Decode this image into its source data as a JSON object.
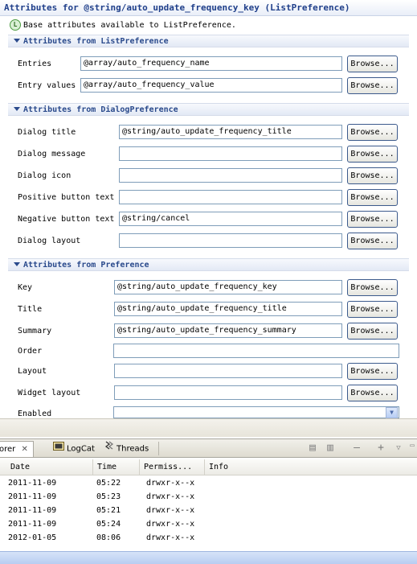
{
  "header": {
    "title": "Attributes for @string/auto_update_frequency_key (ListPreference)"
  },
  "base": {
    "badge": "L",
    "text": "Base attributes available to ListPreference."
  },
  "browse_label": "Browse...",
  "sections": {
    "list": {
      "title": "Attributes from ListPreference",
      "rows": [
        {
          "label": "Entries",
          "value": "@array/auto_frequency_name"
        },
        {
          "label": "Entry values",
          "value": "@array/auto_frequency_value"
        }
      ]
    },
    "dialog": {
      "title": "Attributes from DialogPreference",
      "rows": [
        {
          "label": "Dialog title",
          "value": "@string/auto_update_frequency_title"
        },
        {
          "label": "Dialog message",
          "value": ""
        },
        {
          "label": "Dialog icon",
          "value": ""
        },
        {
          "label": "Positive button text",
          "value": ""
        },
        {
          "label": "Negative button text",
          "value": "@string/cancel"
        },
        {
          "label": "Dialog layout",
          "value": ""
        }
      ]
    },
    "pref": {
      "title": "Attributes from Preference",
      "rows": [
        {
          "label": "Key",
          "value": "@string/auto_update_frequency_key"
        },
        {
          "label": "Title",
          "value": "@string/auto_update_frequency_title"
        },
        {
          "label": "Summary",
          "value": "@string/auto_update_frequency_summary"
        },
        {
          "label": "Order",
          "value": ""
        },
        {
          "label": "Layout",
          "value": ""
        },
        {
          "label": "Widget layout",
          "value": ""
        },
        {
          "label": "Enabled",
          "value": ""
        }
      ]
    }
  },
  "views": {
    "tabs": [
      {
        "label": "orer"
      },
      {
        "label": "LogCat"
      },
      {
        "label": "Threads"
      }
    ]
  },
  "table": {
    "columns": [
      "Date",
      "Time",
      "Permiss...",
      "Info"
    ],
    "rows": [
      [
        "2011-11-09",
        "05:22",
        "drwxr-x--x",
        ""
      ],
      [
        "2011-11-09",
        "05:23",
        "drwxr-x--x",
        ""
      ],
      [
        "2011-11-09",
        "05:21",
        "drwxr-x--x",
        ""
      ],
      [
        "2011-11-09",
        "05:24",
        "drwxr-x--x",
        ""
      ],
      [
        "2012-01-05",
        "08:06",
        "drwxr-x--x",
        ""
      ]
    ]
  },
  "colors": {
    "header_text": "#1f3f8a",
    "section_text": "#2a4a8c",
    "field_border": "#7f9db9"
  }
}
